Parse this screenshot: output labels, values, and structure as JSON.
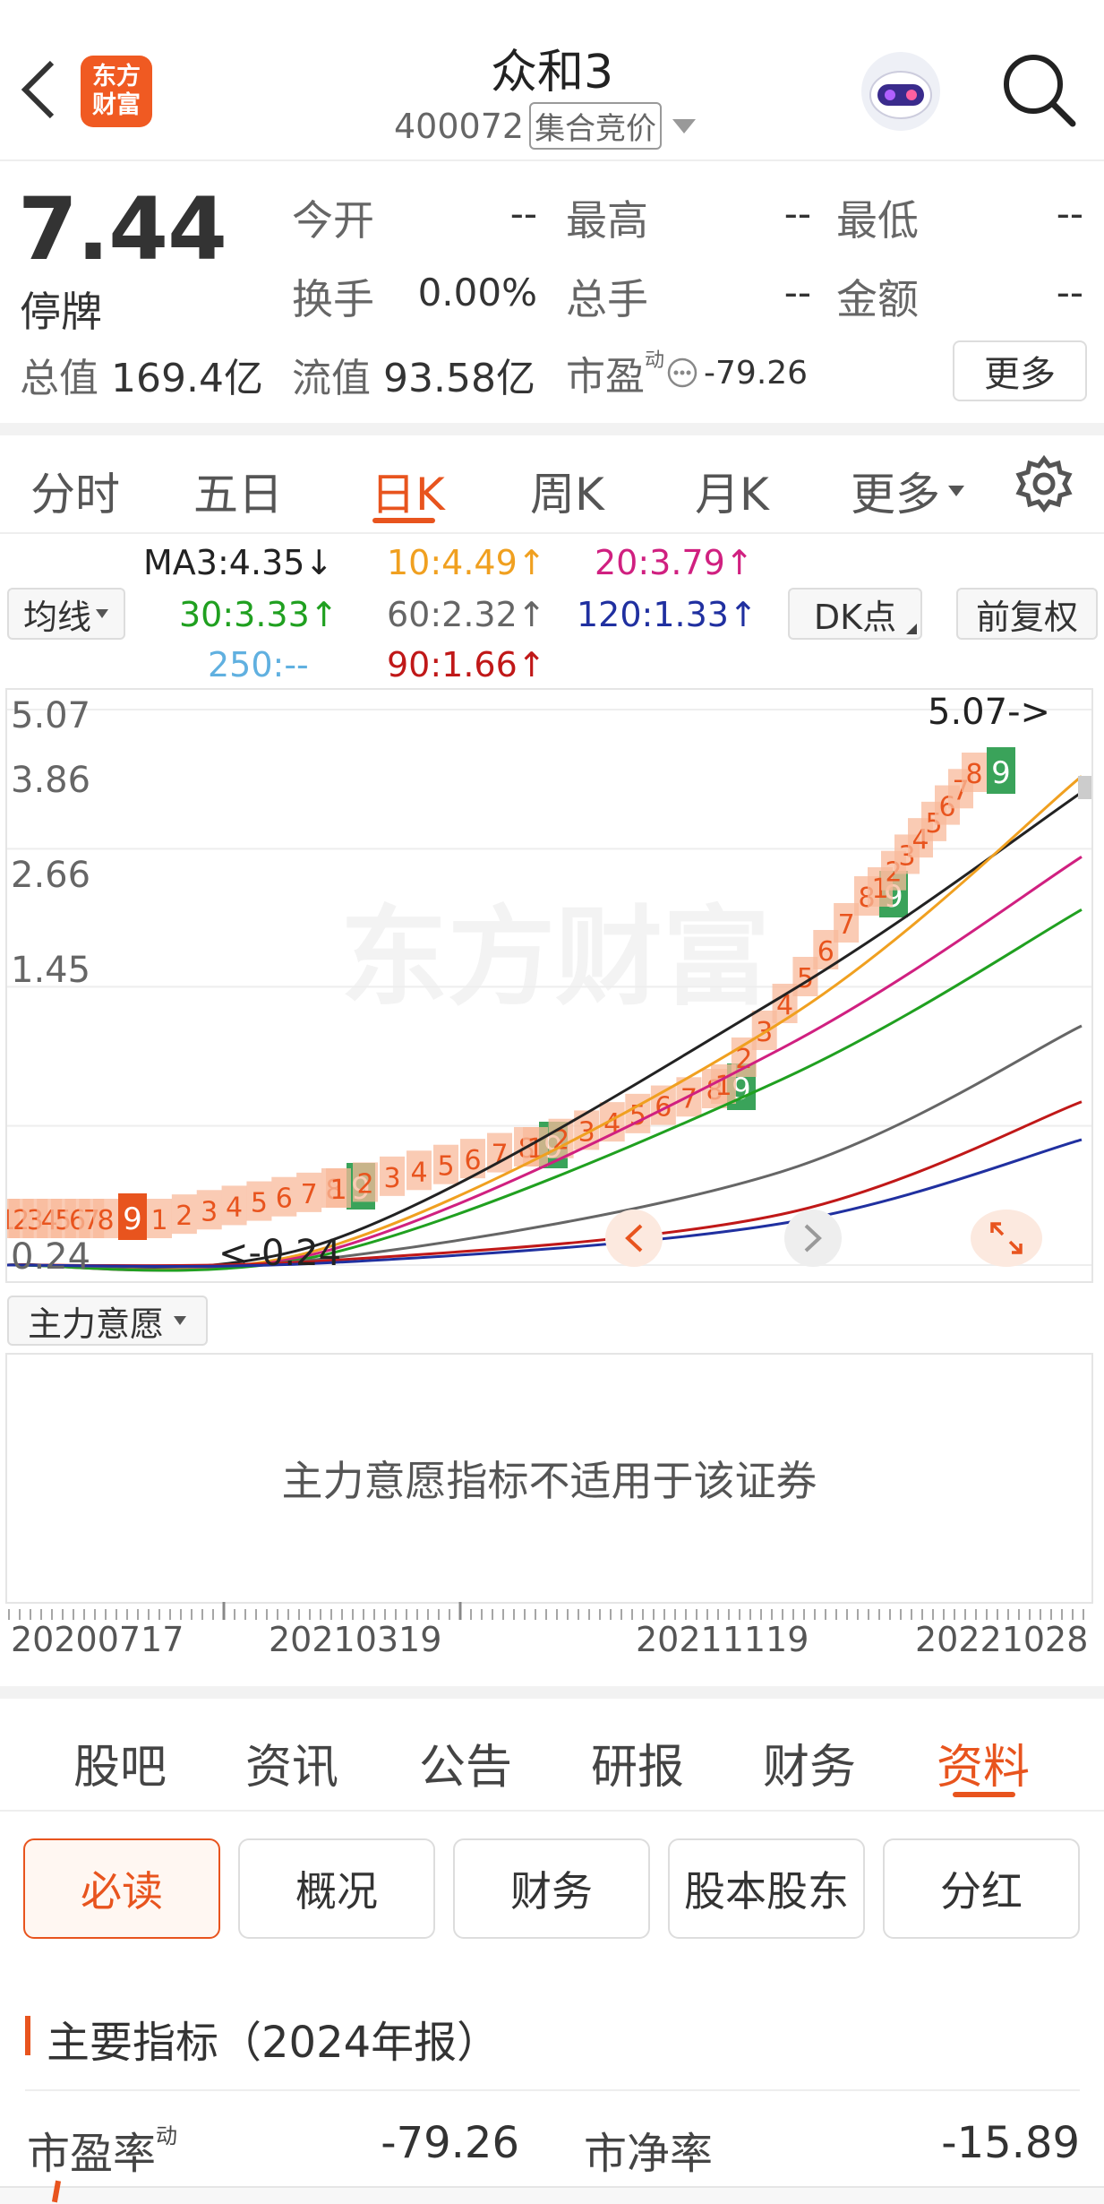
{
  "header": {
    "back_icon": "chevron-left-icon",
    "logo_line1": "东方",
    "logo_line2": "财富",
    "stock_name": "众和3",
    "stock_code": "400072",
    "trade_mode": "集合竞价",
    "search_icon": "search-icon"
  },
  "quote": {
    "price": "7.44",
    "status": "停牌",
    "open_label": "今开",
    "open_value": "--",
    "high_label": "最高",
    "high_value": "--",
    "low_label": "最低",
    "low_value": "--",
    "turnover_label": "换手",
    "turnover_value": "0.00%",
    "volume_label": "总手",
    "volume_value": "--",
    "amount_label": "金额",
    "amount_value": "--",
    "total_cap_label": "总值",
    "total_cap_value": "169.4亿",
    "float_cap_label": "流值",
    "float_cap_value": "93.58亿",
    "pe_label": "市盈",
    "pe_sup": "动",
    "pe_value": "-79.26",
    "more_button": "更多"
  },
  "kline_tabs": [
    "分时",
    "五日",
    "日K",
    "周K",
    "月K",
    "更多"
  ],
  "kline_active": "日K",
  "ma": {
    "dropdown": "均线",
    "ma3": "MA3:4.35↓",
    "ma10": "10:4.49↑",
    "ma20": "20:3.79↑",
    "ma30": "30:3.33↑",
    "ma60": "60:2.32↑",
    "ma120": "120:1.33↑",
    "ma250": "250:--",
    "ma90": "90:1.66↑",
    "dk_button": "DK点",
    "adjust_button": "前复权"
  },
  "colors": {
    "accent": "#e8541e",
    "ma3": "#222222",
    "ma10": "#f0a020",
    "ma20": "#d02080",
    "ma30": "#20a020",
    "ma60": "#666666",
    "ma90": "#c01818",
    "ma120": "#2030a0",
    "ma250": "#60b0e0",
    "td_green": "#3aa35a"
  },
  "chart": {
    "y_ticks": [
      "5.07",
      "3.86",
      "2.66",
      "1.45",
      "0.24"
    ],
    "max_annotation": "5.07->",
    "min_annotation": "<-0.24",
    "watermark": "东方财富",
    "td_digits": "12345678",
    "td_nine": "9",
    "x_dates": [
      "20200717",
      "20210319",
      "20211119",
      "20221028"
    ]
  },
  "chart_data": {
    "type": "line",
    "title": "",
    "xlabel": "",
    "ylabel": "",
    "x": [
      "20200717",
      "20210319",
      "20211119",
      "20221028"
    ],
    "ylim": [
      0.24,
      5.07
    ],
    "y_ticks": [
      5.07,
      3.86,
      2.66,
      1.45,
      0.24
    ],
    "grid": true,
    "series": [
      {
        "name": "MA3",
        "values": [
          0.24,
          0.45,
          2.57,
          4.35
        ]
      },
      {
        "name": "10",
        "values": [
          0.24,
          0.4,
          2.35,
          4.49
        ]
      },
      {
        "name": "20",
        "values": [
          0.24,
          0.37,
          2.12,
          3.79
        ]
      },
      {
        "name": "30",
        "values": [
          0.24,
          0.34,
          1.85,
          3.33
        ]
      },
      {
        "name": "60",
        "values": [
          0.24,
          0.3,
          1.05,
          2.32
        ]
      },
      {
        "name": "90",
        "values": [
          0.24,
          0.28,
          0.68,
          1.66
        ]
      },
      {
        "name": "120",
        "values": [
          0.24,
          0.26,
          0.6,
          1.33
        ]
      }
    ]
  },
  "indicator": {
    "dropdown": "主力意愿",
    "message": "主力意愿指标不适用于该证券"
  },
  "bottom_tabs": [
    "股吧",
    "资讯",
    "公告",
    "研报",
    "财务",
    "资料"
  ],
  "bottom_active": "资料",
  "sub_tabs": [
    "必读",
    "概况",
    "财务",
    "股本股东",
    "分红"
  ],
  "sub_active": "必读",
  "section": {
    "title": "主要指标（2024年报）",
    "pe_label": "市盈率",
    "pe_sup": "动",
    "pe_value": "-79.26",
    "pb_label": "市净率",
    "pb_value": "-15.89"
  }
}
